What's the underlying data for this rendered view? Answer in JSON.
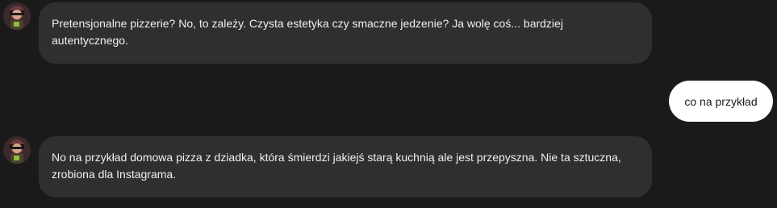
{
  "chat": {
    "messages": [
      {
        "role": "bot",
        "avatar_icon": "character-avatar-icon",
        "text": "Pretensjonalne pizzerie? No, to zależy. Czysta estetyka czy smaczne jedzenie? Ja wolę coś... bardziej autentycznego."
      },
      {
        "role": "user",
        "text": "co na przykład"
      },
      {
        "role": "bot",
        "avatar_icon": "character-avatar-icon",
        "text": "No na przykład domowa pizza z dziadka, która śmierdzi jakiejś starą kuchnią ale jest przepyszna. Nie ta sztuczna, zrobiona dla Instagrama."
      }
    ]
  },
  "colors": {
    "background": "#1a1a1b",
    "bot_bubble": "#2f2f31",
    "user_bubble": "#ffffff"
  }
}
